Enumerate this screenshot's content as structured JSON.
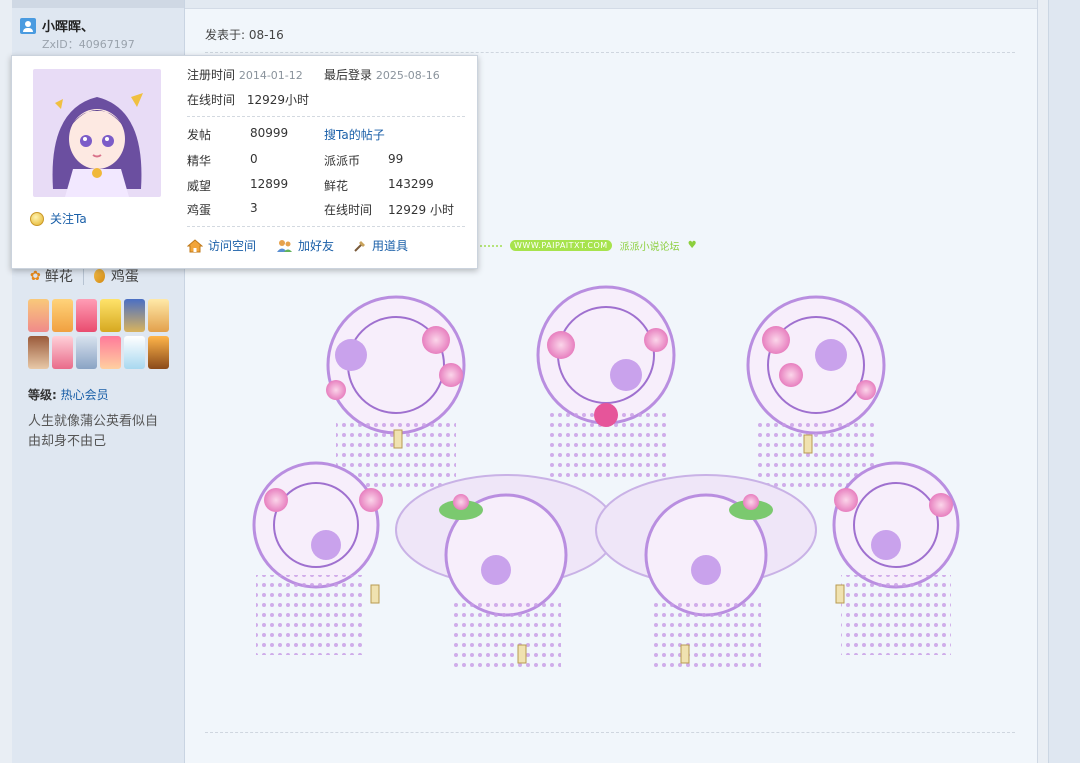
{
  "user": {
    "name": "小晖晖、",
    "zxid": "ZxID：40967197"
  },
  "post": {
    "date": "发表于: 08-16"
  },
  "popup": {
    "follow_label": "关注Ta",
    "register_label": "注册时间",
    "register_value": "2014-01-12",
    "lastlogin_label": "最后登录",
    "lastlogin_value": "2025-08-16",
    "online_label": "在线时间",
    "online_value": "12929小时",
    "stats": [
      {
        "label": "发帖",
        "value": "80999"
      },
      {
        "label": "精华",
        "value": "0"
      },
      {
        "label": "威望",
        "value": "12899"
      },
      {
        "label": "鸡蛋",
        "value": "3"
      }
    ],
    "stats_right": [
      {
        "label": "搜Ta的帖子",
        "value": ""
      },
      {
        "label": "派派币",
        "value": "99"
      },
      {
        "label": "鲜花",
        "value": "143299"
      },
      {
        "label": "在线时间",
        "value": "12929 小时"
      }
    ],
    "actions": {
      "visit": "访问空间",
      "add_friend": "加好友",
      "use_item": "用道具"
    }
  },
  "sidebar": {
    "flowers_label": "鲜花",
    "eggs_label": "鸡蛋",
    "level_label": "等级:",
    "level_value": "热心会员",
    "signature": "人生就像蒲公英看似自由却身不由己"
  },
  "signature_bar": {
    "site_badge": "WWW.PAIPAITXT.COM",
    "site_name": "派派小说论坛"
  },
  "colors": {
    "link": "#1a5fa8",
    "accent_green": "#a7e34d",
    "lantern_purple": "#b98ee0",
    "lantern_pink": "#f2a8d0"
  }
}
